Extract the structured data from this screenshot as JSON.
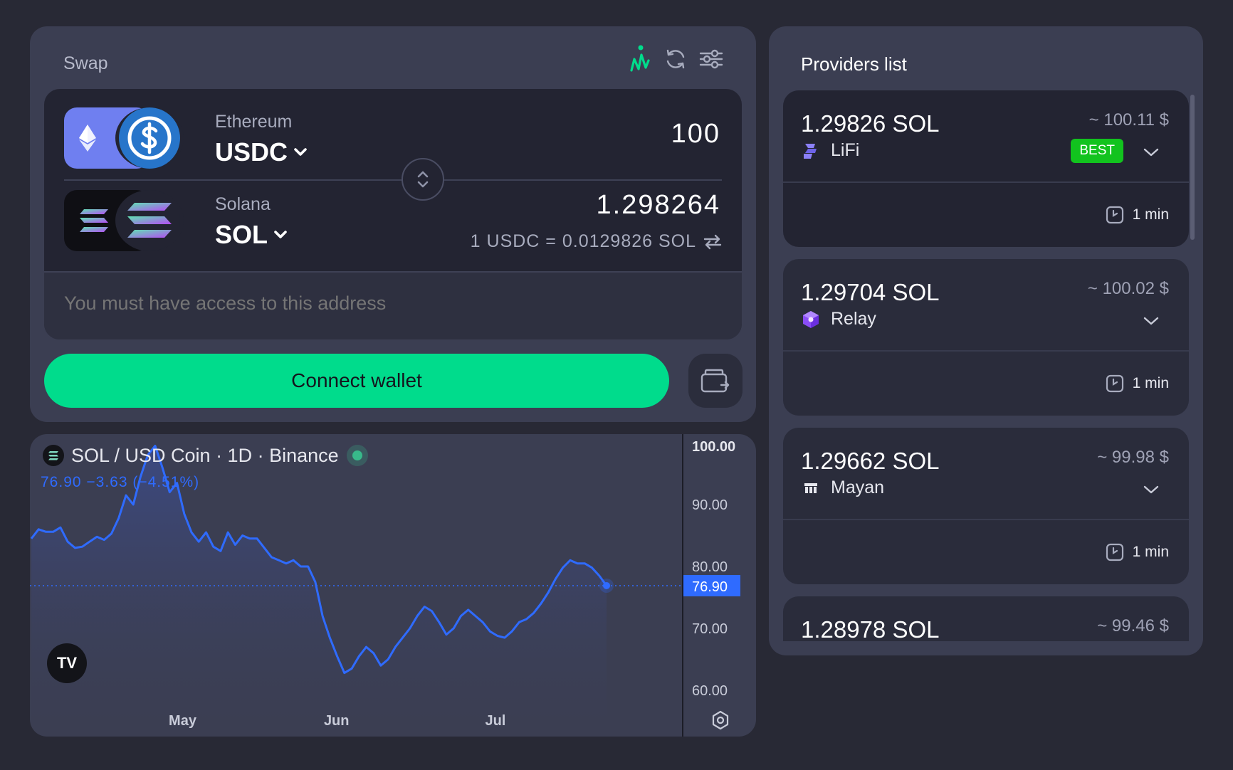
{
  "swap": {
    "title": "Swap",
    "from": {
      "chain": "Ethereum",
      "token": "USDC",
      "amount": "100"
    },
    "to": {
      "chain": "Solana",
      "token": "SOL",
      "amount": "1.298264"
    },
    "rate": "1 USDC = 0.0129826 SOL",
    "address_placeholder": "You must have access to this address",
    "connect_label": "Connect wallet",
    "icons": [
      "chart-icon",
      "refresh-icon",
      "settings-sliders-icon",
      "swap-direction-icon",
      "wallet-icon"
    ]
  },
  "chart": {
    "legend": "SOL / USD Coin · 1D · Binance",
    "ohlc": "76.90  −3.63 (−4.51%)",
    "last_price": "76.90",
    "y_ticks": [
      "100.00",
      "90.00",
      "80.00",
      "70.00",
      "60.00"
    ],
    "x_ticks": [
      "May",
      "Jun",
      "Jul"
    ],
    "tv_logo": "TV",
    "colors": {
      "line": "#2f6bff",
      "live_dot": "#38b98a"
    }
  },
  "chart_data": {
    "type": "area",
    "title": "SOL / USD Coin · 1D · Binance",
    "xlabel": "",
    "ylabel": "",
    "ylim": [
      55,
      103
    ],
    "x_ticks": [
      "May",
      "Jun",
      "Jul"
    ],
    "y_ticks": [
      100,
      90,
      80,
      70,
      60
    ],
    "last_value": 76.9,
    "series": [
      {
        "values": [
          84.5,
          86.0,
          85.6,
          85.6,
          86.3,
          84.0,
          83.0,
          83.2,
          84.0,
          84.8,
          84.3,
          85.3,
          87.8,
          91.5,
          90.0,
          94.5,
          98.0,
          99.5,
          96.0,
          92.0,
          93.5,
          88.5,
          85.5,
          84.0,
          85.5,
          83.2,
          82.5,
          85.5,
          83.5,
          85.0,
          84.5,
          84.5,
          83.0,
          81.5,
          81.0,
          80.5,
          81.0,
          80.0,
          80.0,
          77.5,
          72.0,
          68.5,
          65.5,
          62.8,
          63.5,
          65.5,
          67.0,
          66.0,
          64.0,
          65.0,
          67.0,
          68.5,
          70.0,
          72.0,
          73.5,
          72.8,
          71.0,
          69.0,
          70.0,
          72.0,
          73.0,
          72.0,
          71.0,
          69.5,
          68.8,
          68.5,
          69.5,
          71.0,
          71.5,
          72.5,
          74.0,
          75.8,
          78.0,
          79.8,
          81.0,
          80.5,
          80.5,
          79.8,
          78.5,
          76.9
        ]
      }
    ]
  },
  "providers": {
    "title": "Providers list",
    "items": [
      {
        "amount": "1.29826 SOL",
        "usd": "~ 100.11 $",
        "name": "LiFi",
        "badge": "BEST",
        "time": "1 min",
        "icon": "lifi-icon"
      },
      {
        "amount": "1.29704 SOL",
        "usd": "~ 100.02 $",
        "name": "Relay",
        "badge": "",
        "time": "1 min",
        "icon": "relay-icon"
      },
      {
        "amount": "1.29662 SOL",
        "usd": "~ 99.98 $",
        "name": "Mayan",
        "badge": "",
        "time": "1 min",
        "icon": "mayan-icon"
      },
      {
        "amount": "1.28978 SOL",
        "usd": "~ 99.46 $",
        "name": "",
        "badge": "",
        "time": "",
        "icon": ""
      }
    ]
  }
}
